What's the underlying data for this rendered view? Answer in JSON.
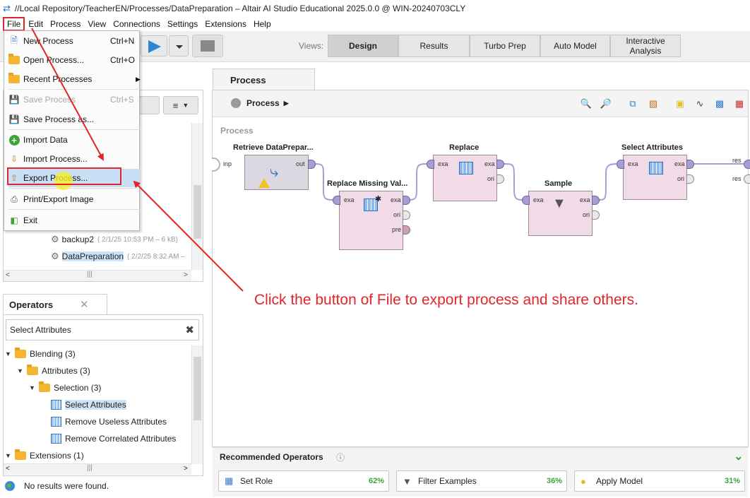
{
  "window": {
    "title": "//Local Repository/TeacherEN/Processes/DataPreparation – Altair AI Studio Educational 2025.0.0 @ WIN-20240703CLY"
  },
  "menubar": [
    "File",
    "Edit",
    "Process",
    "View",
    "Connections",
    "Settings",
    "Extensions",
    "Help"
  ],
  "toolbar": {
    "views_label": "Views:",
    "views": [
      "Design",
      "Results",
      "Turbo Prep",
      "Auto Model",
      "Interactive Analysis"
    ],
    "active_view": "Design"
  },
  "file_menu": {
    "items": [
      {
        "label": "New Process",
        "shortcut": "Ctrl+N"
      },
      {
        "label": "Open Process...",
        "shortcut": "Ctrl+O"
      },
      {
        "label": "Recent Processes",
        "shortcut": ""
      },
      {
        "label": "Save Process",
        "shortcut": "Ctrl+S"
      },
      {
        "label": "Save Process as...",
        "shortcut": ""
      },
      {
        "label": "Import Data",
        "shortcut": ""
      },
      {
        "label": "Import Process...",
        "shortcut": ""
      },
      {
        "label": "Export Process...",
        "shortcut": ""
      },
      {
        "label": "Print/Export Image",
        "shortcut": ""
      },
      {
        "label": "Exit",
        "shortcut": ""
      }
    ],
    "highlighted": "Export Process..."
  },
  "repository": {
    "items": [
      {
        "name": "backup2",
        "meta": "( 2/1/25 10:53 PM – 6 kB)"
      },
      {
        "name": "DataPreparation",
        "meta": "( 2/2/25 8:32 AM –"
      }
    ]
  },
  "operators_panel": {
    "tab_label": "Operators",
    "search_value": "Select Attributes",
    "tree": [
      {
        "label": "Blending (3)",
        "level": 0,
        "type": "folder"
      },
      {
        "label": "Attributes (3)",
        "level": 1,
        "type": "folder"
      },
      {
        "label": "Selection (3)",
        "level": 2,
        "type": "folder"
      },
      {
        "label": "Select Attributes",
        "level": 3,
        "type": "operator"
      },
      {
        "label": "Remove Useless Attributes",
        "level": 3,
        "type": "operator"
      },
      {
        "label": "Remove Correlated Attributes",
        "level": 3,
        "type": "operator"
      },
      {
        "label": "Extensions (1)",
        "level": 0,
        "type": "folder"
      }
    ],
    "status": "No results were found."
  },
  "process_panel": {
    "tab_label": "Process",
    "breadcrumb": "Process",
    "canvas_label": "Process",
    "operators": {
      "retrieve": {
        "title": "Retrieve DataPrepar...",
        "ports_out": [
          "out"
        ]
      },
      "replace_missing": {
        "title": "Replace Missing Val...",
        "ports_in": [
          "exa"
        ],
        "ports_out": [
          "exa",
          "ori",
          "pre"
        ]
      },
      "replace": {
        "title": "Replace",
        "ports_in": [
          "exa"
        ],
        "ports_out": [
          "exa",
          "ori"
        ]
      },
      "sample": {
        "title": "Sample",
        "ports_in": [
          "exa"
        ],
        "ports_out": [
          "exa",
          "ori"
        ]
      },
      "select_attributes": {
        "title": "Select Attributes",
        "ports_in": [
          "exa"
        ],
        "ports_out": [
          "exa",
          "ori"
        ]
      }
    },
    "input_port": "inp",
    "result_ports": [
      "res",
      "res"
    ]
  },
  "recommended": {
    "title": "Recommended Operators",
    "items": [
      {
        "label": "Set Role",
        "pct": "62%"
      },
      {
        "label": "Filter Examples",
        "pct": "36%"
      },
      {
        "label": "Apply Model",
        "pct": "31%"
      }
    ]
  },
  "annotation": "Click the button of File to export process and share others.",
  "colors": {
    "annotation": "#e0262a",
    "highlight_box": "#e0262a",
    "operator_fill": "#f1dbe7",
    "port": "#a89ed6",
    "connection": "#a89ed6"
  }
}
